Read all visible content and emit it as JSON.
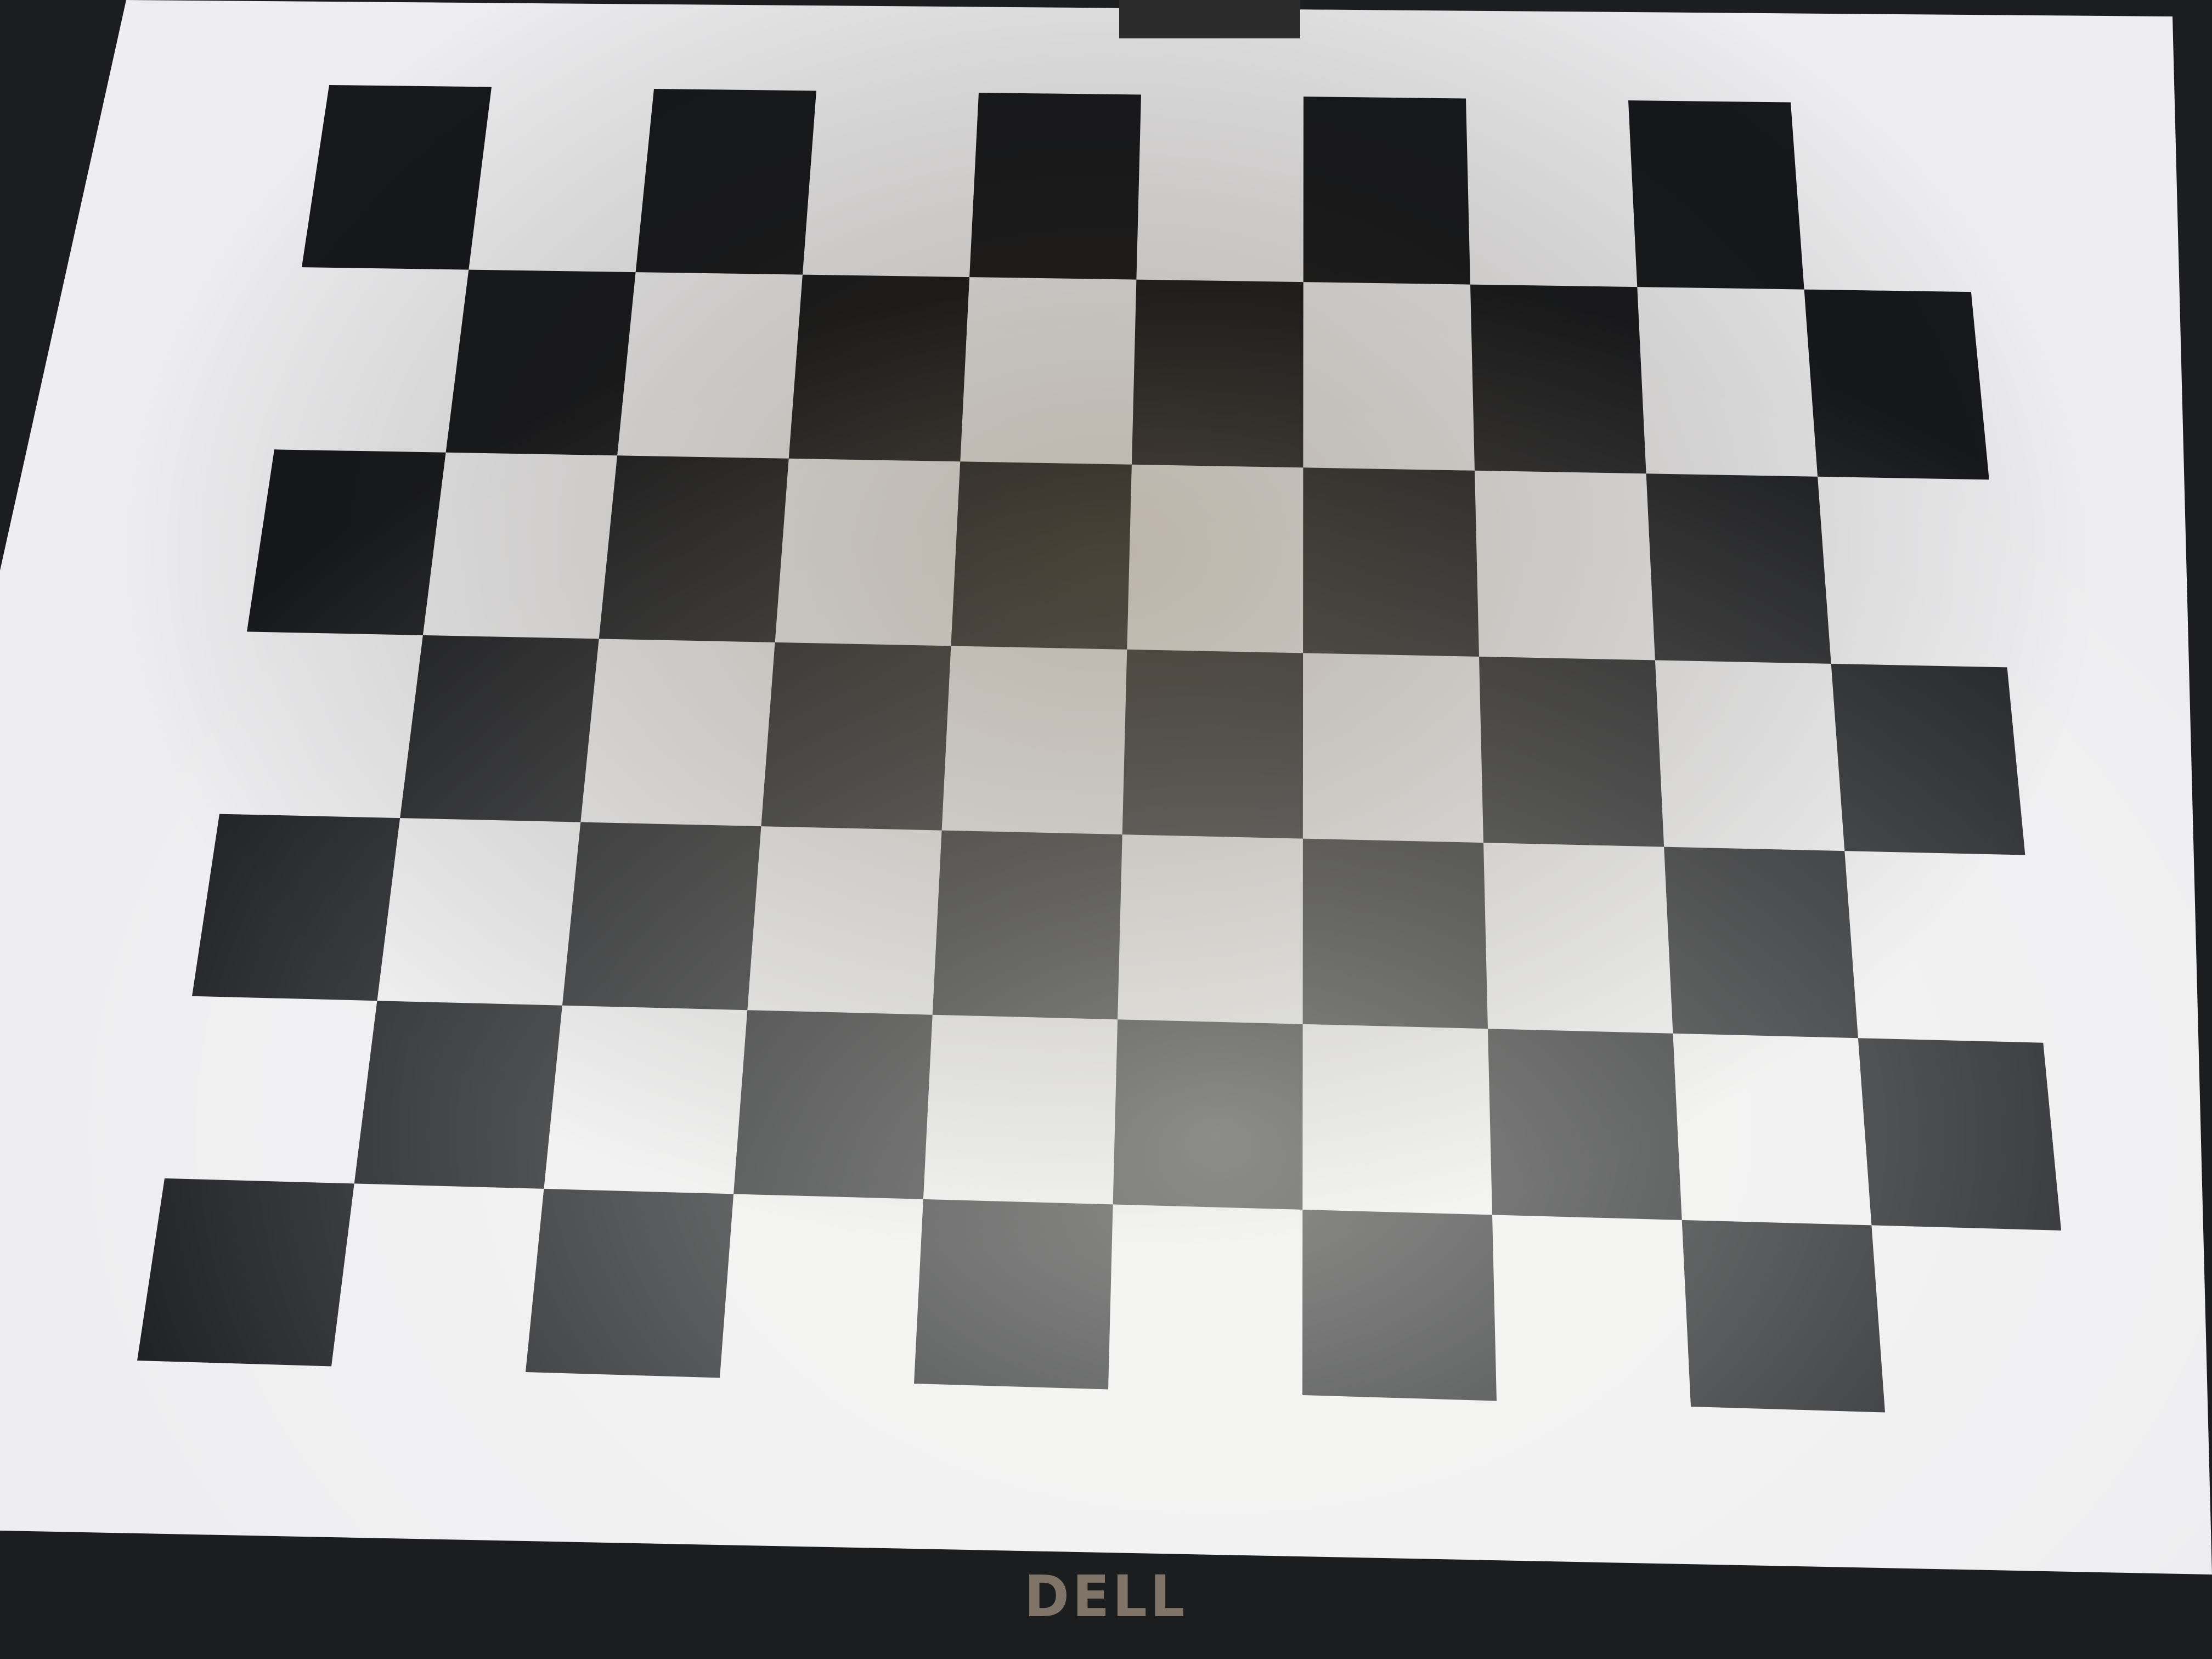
{
  "monitor": {
    "brand_logo": "DELL"
  },
  "checkerboard": {
    "rows": 7,
    "columns": 10,
    "top_left_square": "dark"
  },
  "colors": {
    "screen": "#eeeef0",
    "dark_square": "#16181c",
    "bezel": "#1c1d1f",
    "logo": "#7f7467"
  }
}
